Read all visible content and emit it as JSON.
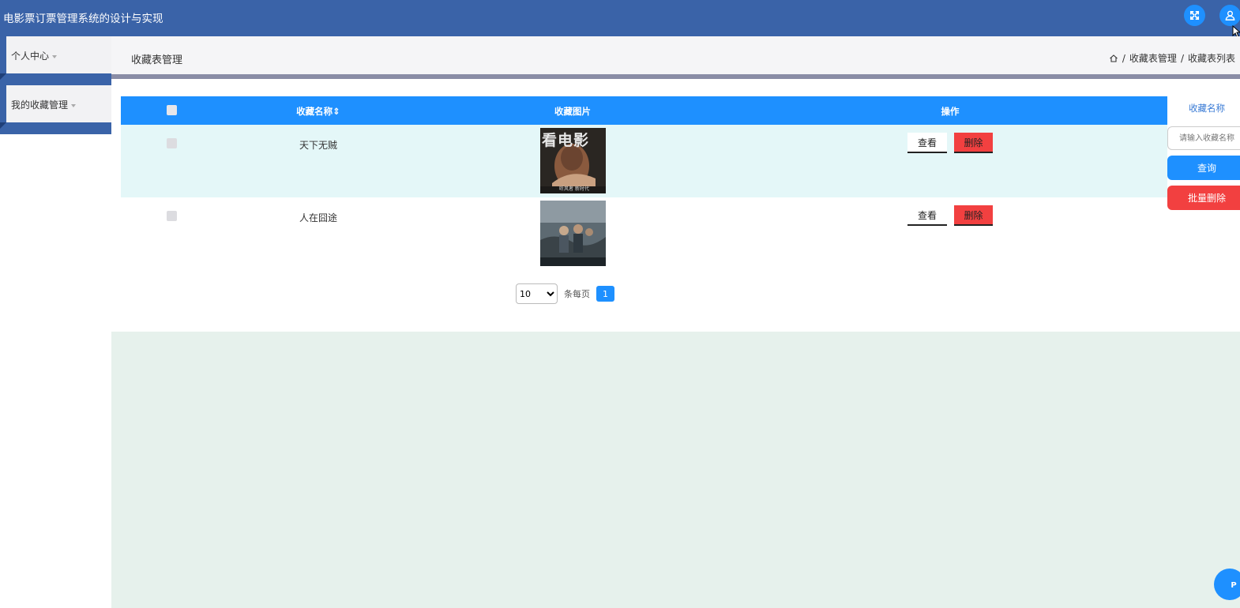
{
  "app": {
    "title": "电影票订票管理系统的设计与实现"
  },
  "header_icons": [
    {
      "name": "fullscreen-icon",
      "color": "#1e90ff"
    },
    {
      "name": "user-icon",
      "color": "#1e90ff"
    }
  ],
  "sidebar": {
    "items": [
      {
        "label": "个人中心"
      },
      {
        "label": "我的收藏管理"
      }
    ]
  },
  "page": {
    "heading": "收藏表管理",
    "breadcrumb": [
      "收藏表管理",
      "收藏表列表"
    ],
    "breadcrumb_sep": "/"
  },
  "table": {
    "columns": {
      "name": "收藏名称",
      "sort_glyph": "⇕",
      "image": "收藏图片",
      "actions": "操作"
    },
    "rows": [
      {
        "name": "天下无贼",
        "poster_text": "看电影",
        "poster_caption": "听风者 新时代"
      },
      {
        "name": "人在囧途",
        "poster_text": "",
        "poster_caption": ""
      }
    ],
    "view_label": "查看",
    "delete_label": "删除"
  },
  "pagination": {
    "page_size": "10",
    "per_page_label": "条每页",
    "current_page": "1"
  },
  "search": {
    "label": "收藏名称",
    "placeholder": "请输入收藏名称",
    "query_label": "查询",
    "batch_delete_label": "批量删除"
  },
  "floating_button": {
    "label": "P"
  },
  "colors": {
    "topbar": "#3a63a8",
    "primary": "#1e90ff",
    "danger": "#f24040",
    "row_highlight": "#e4f7f8"
  }
}
